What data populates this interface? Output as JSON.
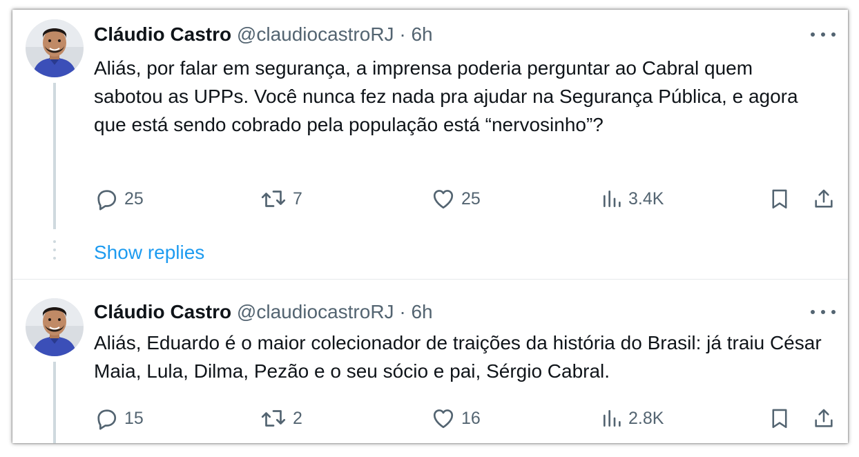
{
  "tweets": [
    {
      "author_name": "Cláudio Castro",
      "handle": "@claudiocastroRJ",
      "separator": "·",
      "time": "6h",
      "text": "Aliás, por falar em segurança, a imprensa poderia perguntar ao Cabral quem sabotou as UPPs. Você nunca fez nada pra ajudar na Segurança Pública, e agora que está sendo cobrado pela população está “nervosinho”?",
      "replies": "25",
      "retweets": "7",
      "likes": "25",
      "views": "3.4K"
    },
    {
      "author_name": "Cláudio Castro",
      "handle": "@claudiocastroRJ",
      "separator": "·",
      "time": "6h",
      "text": "Aliás, Eduardo é o maior colecionador de traições da história do Brasil: já traiu César Maia, Lula, Dilma, Pezão e o seu sócio e pai, Sérgio Cabral.",
      "replies": "15",
      "retweets": "2",
      "likes": "16",
      "views": "2.8K"
    }
  ],
  "show_replies_label": "Show replies",
  "colors": {
    "link": "#1d9bf0",
    "text": "#0f1419",
    "muted": "#536471",
    "thread_line": "#cfd9de"
  }
}
